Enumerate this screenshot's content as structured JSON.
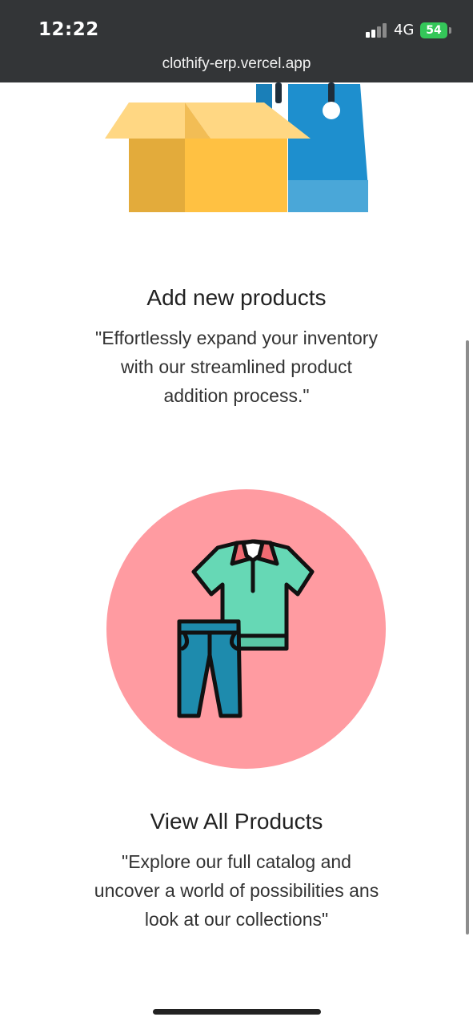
{
  "status_bar": {
    "time": "12:22",
    "network": "4G",
    "battery": "54"
  },
  "browser": {
    "url": "clothify-erp.vercel.app"
  },
  "cards": [
    {
      "title": "Add new products",
      "description_lines": [
        "\"Effortlessly expand your inventory",
        "with our streamlined product",
        "addition process.\""
      ],
      "icon": "open-box-and-shopping-bag-icon"
    },
    {
      "title": "View All Products",
      "description_lines": [
        "\"Explore our full catalog and",
        "uncover a world of possibilities ans",
        "look at our collections\""
      ],
      "icon": "shirt-and-jeans-icon"
    }
  ],
  "colors": {
    "status_bar_bg": "#333537",
    "circle_bg": "#ff9ba1",
    "box_yellow": "#ffc142",
    "bag_blue": "#1e8fce",
    "shirt_green": "#66d8b5",
    "jeans_blue": "#1e8bad",
    "battery_green": "#34c759"
  }
}
